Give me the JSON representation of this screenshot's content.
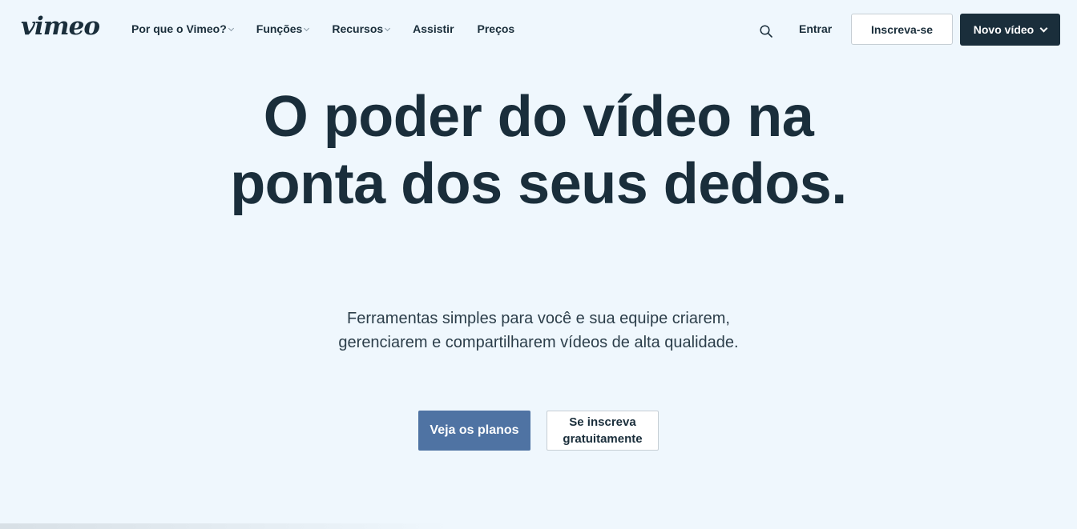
{
  "header": {
    "logo": "vimeo",
    "nav": [
      {
        "label": "Por que o Vimeo?",
        "has_dropdown": true
      },
      {
        "label": "Funções",
        "has_dropdown": true
      },
      {
        "label": "Recursos",
        "has_dropdown": true
      },
      {
        "label": "Assistir",
        "has_dropdown": false
      },
      {
        "label": "Preços",
        "has_dropdown": false
      }
    ],
    "search_icon": "search-icon",
    "login_label": "Entrar",
    "signup_label": "Inscreva-se",
    "new_video_label": "Novo vídeo"
  },
  "hero": {
    "title": "O poder do vídeo na ponta dos seus dedos.",
    "subtitle": "Ferramentas simples para você e sua equipe criarem, gerenciarem e compartilharem vídeos de alta qualidade.",
    "primary_cta": "Veja os planos",
    "secondary_cta": "Se inscreva gratuitamente"
  },
  "colors": {
    "background": "#eff7fd",
    "text_dark": "#1a2e3b",
    "primary_button": "#4f73a3",
    "dark_button": "#1a2e3b"
  }
}
